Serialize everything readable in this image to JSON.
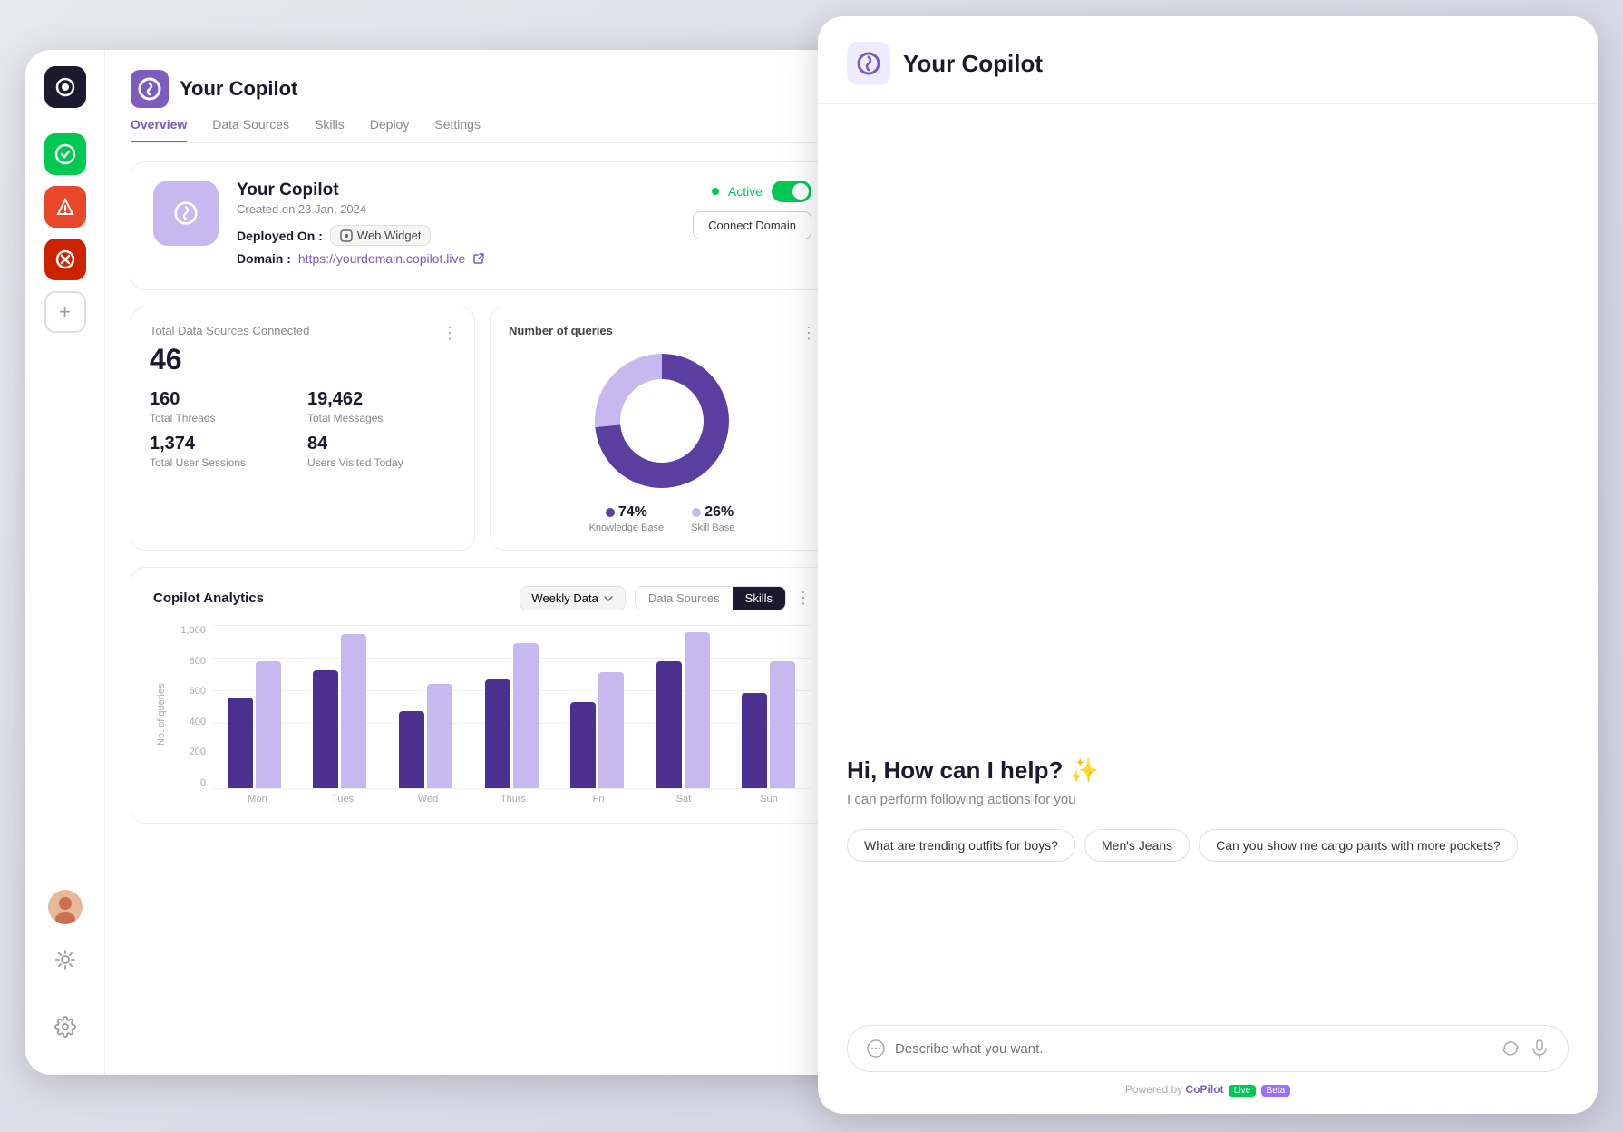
{
  "dashboard": {
    "title": "Your Copilot",
    "logo_alt": "copilot-logo",
    "created_on": "Created on 23 Jan, 2024",
    "deployed_on_label": "Deployed On :",
    "widget_label": "Web Widget",
    "domain_label": "Domain :",
    "domain_url": "https://yourdomain.copilot.live",
    "connect_domain_btn": "Connect Domain",
    "status_label": "Active",
    "nav_tabs": [
      "Overview",
      "Data Sources",
      "Skills",
      "Deploy",
      "Settings"
    ],
    "active_tab": "Overview",
    "stats": {
      "total_sources_label": "Total Data Sources Connected",
      "total_sources_value": "46",
      "threads_value": "160",
      "threads_label": "Total Threads",
      "messages_value": "19,462",
      "messages_label": "Total Messages",
      "sessions_value": "1,374",
      "sessions_label": "Total User Sessions",
      "visited_value": "84",
      "visited_label": "Users Visited Today"
    },
    "queries": {
      "title": "Number of queries",
      "kb_pct": "74%",
      "kb_label": "Knowledge Base",
      "skill_pct": "26%",
      "skill_label": "Skill Base"
    },
    "analytics": {
      "title": "Copilot Analytics",
      "weekly_selector": "Weekly Data",
      "toggle_options": [
        "Data Sources",
        "Skills"
      ],
      "active_toggle": "Skills",
      "y_labels": [
        "1,000",
        "800",
        "600",
        "400",
        "200",
        "0"
      ],
      "x_labels": [
        "Mon",
        "Tues",
        "Wed",
        "Thurs",
        "Fri",
        "Sat",
        "Sun"
      ],
      "y_axis_label": "No. of queries",
      "bars": [
        {
          "dark": 55,
          "light": 75
        },
        {
          "dark": 70,
          "light": 95
        },
        {
          "dark": 45,
          "light": 60
        },
        {
          "dark": 65,
          "light": 90
        },
        {
          "dark": 50,
          "light": 70
        },
        {
          "dark": 75,
          "light": 95
        },
        {
          "dark": 55,
          "light": 75
        }
      ]
    }
  },
  "copilot_panel": {
    "title": "Your Copilot",
    "greeting": "Hi, How can I help? ✨",
    "subtitle": "I can perform following actions for you",
    "chips": [
      "What are trending outfits for boys?",
      "Men's Jeans",
      "Can you show me cargo pants with more pockets?"
    ],
    "input_placeholder": "Describe what you want..",
    "footer_text": "Powered by",
    "footer_brand": "CoPilot",
    "footer_badge": "Live",
    "footer_beta": "Beta"
  },
  "sidebar": {
    "items": [
      {
        "label": "green-app",
        "color": "green"
      },
      {
        "label": "red-orange-app",
        "color": "red-orange"
      },
      {
        "label": "red-dark-app",
        "color": "red-dark"
      }
    ],
    "add_label": "+"
  }
}
